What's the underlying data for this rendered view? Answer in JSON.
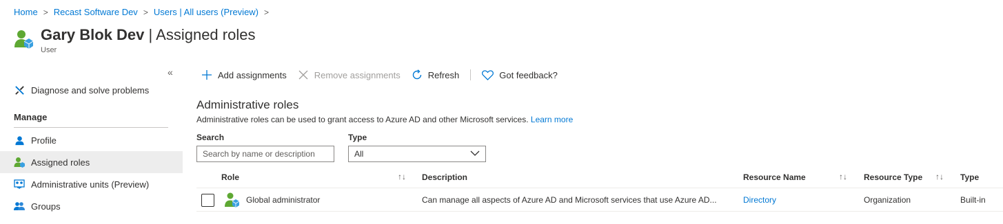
{
  "breadcrumb": {
    "items": [
      "Home",
      "Recast Software Dev",
      "Users | All users (Preview)"
    ],
    "separator": ">"
  },
  "header": {
    "name": "Gary Blok Dev",
    "divider": "|",
    "page": "Assigned roles",
    "subtitle": "User",
    "icon": "user-icon"
  },
  "sidebar": {
    "collapse_glyph": "«",
    "diagnose_label": "Diagnose and solve problems",
    "section_manage": "Manage",
    "items": [
      {
        "label": "Profile",
        "icon": "profile-icon"
      },
      {
        "label": "Assigned roles",
        "icon": "assigned-roles-icon",
        "active": true
      },
      {
        "label": "Administrative units (Preview)",
        "icon": "admin-units-icon"
      },
      {
        "label": "Groups",
        "icon": "groups-icon"
      }
    ]
  },
  "toolbar": {
    "add": "Add assignments",
    "remove": "Remove assignments",
    "refresh": "Refresh",
    "feedback": "Got feedback?"
  },
  "content": {
    "title": "Administrative roles",
    "description": "Administrative roles can be used to grant access to Azure AD and other Microsoft services.",
    "learn_more": "Learn more"
  },
  "filters": {
    "search_label": "Search",
    "search_placeholder": "Search by name or description",
    "type_label": "Type",
    "type_value": "All"
  },
  "table": {
    "columns": [
      "Role",
      "Description",
      "Resource Name",
      "Resource Type",
      "Type"
    ],
    "sort_glyph": "↑↓",
    "rows": [
      {
        "role": "Global administrator",
        "description": "Can manage all aspects of Azure AD and Microsoft services that use Azure AD...",
        "resource_name": "Directory",
        "resource_type": "Organization",
        "type": "Built-in"
      }
    ]
  },
  "colors": {
    "accent": "#0078d4",
    "active_nav": "#ededed",
    "user_green": "#5ea833"
  }
}
